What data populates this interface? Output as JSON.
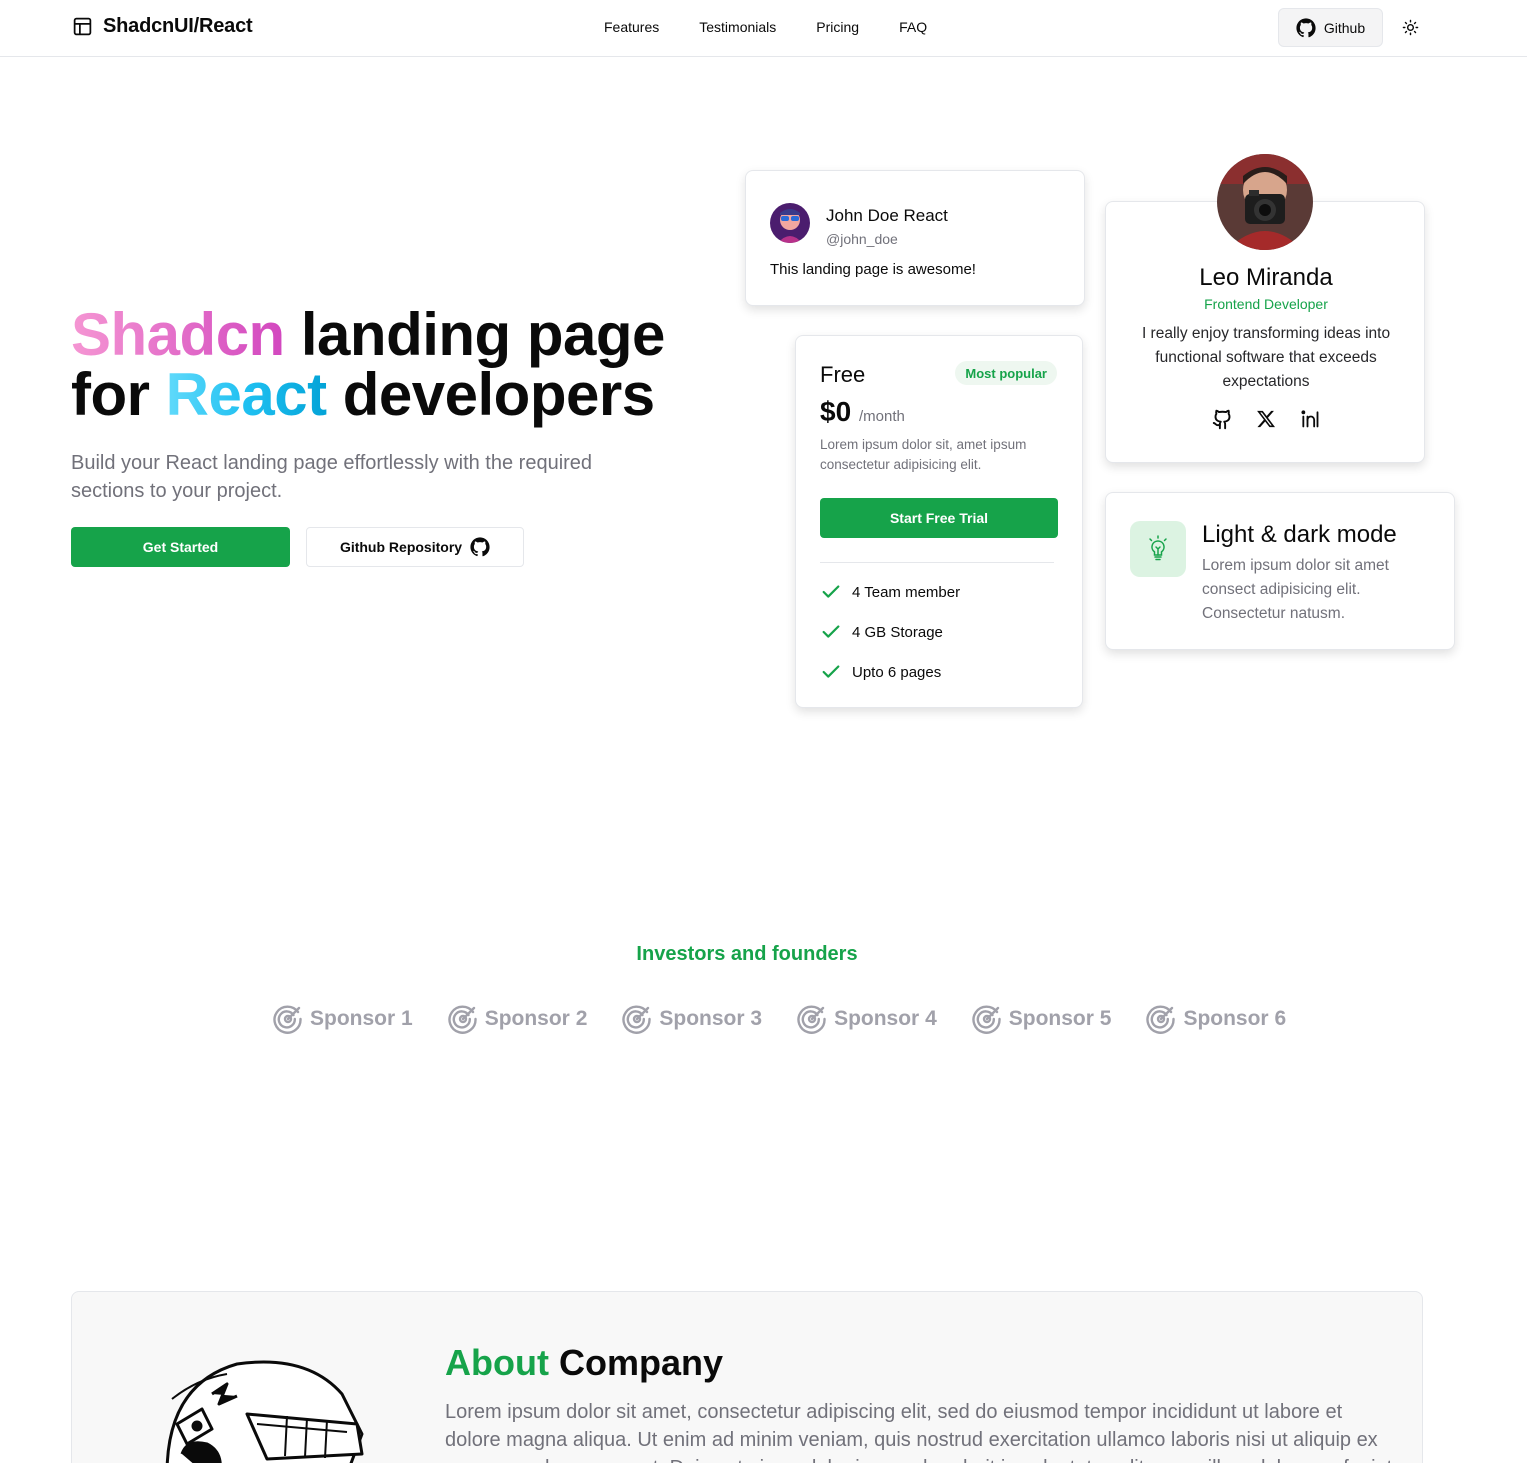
{
  "brand": {
    "name": "ShadcnUI/React"
  },
  "nav": {
    "links": [
      "Features",
      "Testimonials",
      "Pricing",
      "FAQ"
    ],
    "github_label": "Github"
  },
  "hero": {
    "title_part1": "Shadcn",
    "title_part2": " landing page",
    "title_part3": "for ",
    "title_part4": "React",
    "title_part5": " developers",
    "subtitle": "Build your React landing page effortlessly with the required sections to your project.",
    "primary_cta": "Get Started",
    "secondary_cta": "Github Repository"
  },
  "testimonial": {
    "name": "John Doe React",
    "handle": "@john_doe",
    "quote": "This landing page is awesome!"
  },
  "team": {
    "name": "Leo Miranda",
    "role": "Frontend Developer",
    "bio": "I really enjoy transforming ideas into functional software that exceeds expectations",
    "socials": [
      "github-icon",
      "x-icon",
      "linkedin-icon"
    ]
  },
  "pricing": {
    "plan": "Free",
    "badge": "Most popular",
    "price": "$0",
    "period": "/month",
    "description": "Lorem ipsum dolor sit, amet ipsum consectetur adipisicing elit.",
    "cta": "Start Free Trial",
    "features": [
      "4 Team member",
      "4 GB Storage",
      "Upto 6 pages"
    ]
  },
  "feature": {
    "title": "Light & dark mode",
    "description": "Lorem ipsum dolor sit amet consect adipisicing elit. Consectetur natusm."
  },
  "sponsors": {
    "title": "Investors and founders",
    "items": [
      "Sponsor 1",
      "Sponsor 2",
      "Sponsor 3",
      "Sponsor 4",
      "Sponsor 5",
      "Sponsor 6"
    ]
  },
  "about": {
    "title_accent": "About",
    "title_rest": " Company",
    "text": "Lorem ipsum dolor sit amet, consectetur adipiscing elit, sed do eiusmod tempor incididunt ut labore et dolore magna aliqua. Ut enim ad minim veniam, quis nostrud exercitation ullamco laboris nisi ut aliquip ex ea commodo consequat. Duis aute irure dolor in reprehenderit in voluptate velit esse cillum dolore eu fugiat nulla pariatur."
  },
  "colors": {
    "accent": "#16a34a",
    "muted_text": "#71717a",
    "border": "#e5e7eb"
  }
}
